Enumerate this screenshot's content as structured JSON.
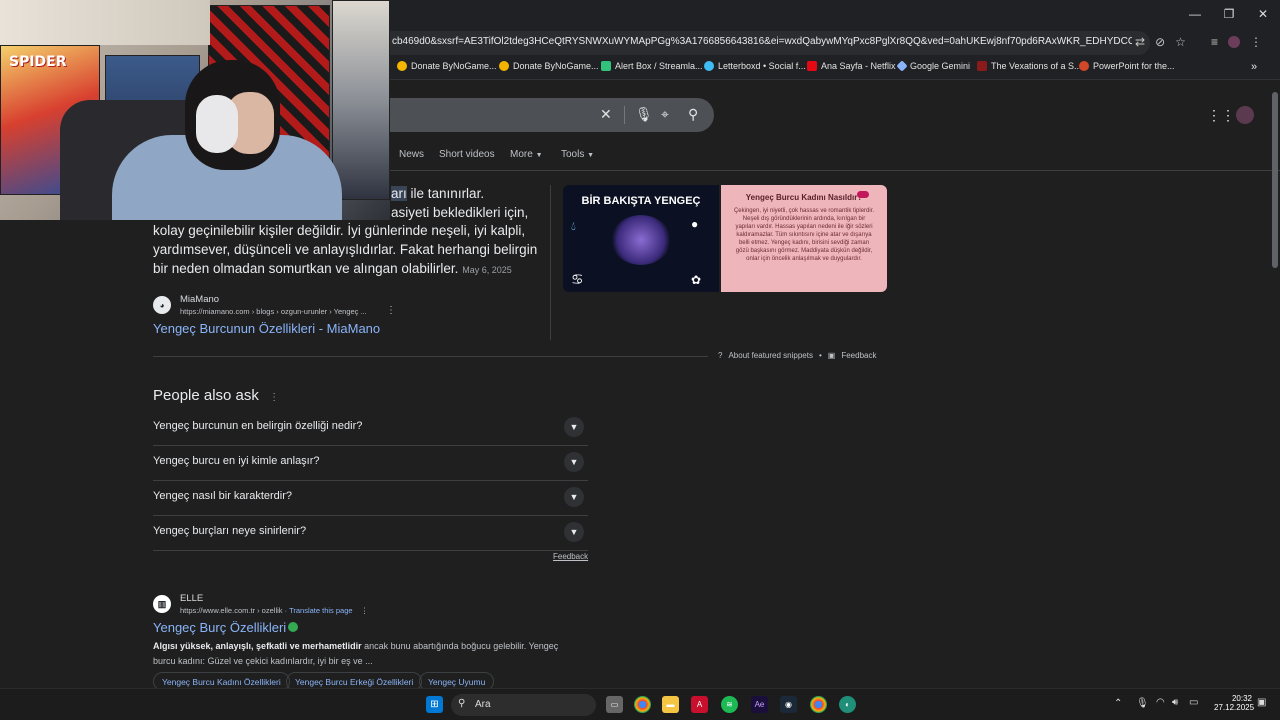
{
  "window": {
    "minimize": "—",
    "maximize": "❐",
    "close": "✕"
  },
  "url": "cb469d0&sxsrf=AE3TifOl2tdeg3HCeQtRYSNWXuWYMApPGg%3A1766856643816&ei=wxdQabywMYqPxc8PglXr8QQ&ved=0ahUKEwj8nf70pd6RAxWKR_EDHYDCOk4Q4dUDCBA...",
  "bookmarks": [
    {
      "label": "Donate ByNoGame...",
      "color": "#f5b400"
    },
    {
      "label": "Donate ByNoGame...",
      "color": "#f5b400"
    },
    {
      "label": "Alert Box / Streamla...",
      "color": "#31c27c"
    },
    {
      "label": "Letterboxd • Social f...",
      "color": "#40bcf4"
    },
    {
      "label": "Ana Sayfa - Netflix",
      "color": "#e50914"
    },
    {
      "label": "Google Gemini",
      "color": "#8ab4f8"
    },
    {
      "label": "The Vexations of a S...",
      "color": "#8b1a1a"
    },
    {
      "label": "PowerPoint for the...",
      "color": "#d24726"
    }
  ],
  "tabs": {
    "news": "News",
    "short_videos": "Short videos",
    "more": "More",
    "tools": "Tools"
  },
  "snippet": {
    "line0a": "arı",
    "line0b": "ile tanınırlar.",
    "line1": "asiyeti bekledikleri için,",
    "line2": "kolay geçinilebilir kişiler değildir. İyi günlerinde neşeli, iyi kalpli,",
    "line3": "yardımsever, düşünceli ve anlayışlıdırlar. Fakat herhangi belirgin",
    "line4": "bir neden olmadan somurtkan ve alıngan olabilirler.",
    "date": "May 6, 2025",
    "source_name": "MiaMano",
    "source_url": "https://miamano.com › blogs › ozgun-urunler › Yengeç ...",
    "link": "Yengeç Burcunun Özellikleri - MiaMano",
    "about": "About featured snippets",
    "feedback": "Feedback"
  },
  "images": {
    "img1_title": "BİR BAKIŞTA YENGEÇ",
    "img2_title": "Yengeç Burcu Kadını Nasıldır?",
    "img2_text": "Çekingen, iyi niyetli, çok hassas ve romantik tiplerdir. Neşeli dış göründüklerinin ardında, kırılgan bir yapıları vardır. Hassas yapıları nedeni ile iğir sözleri kaldıramazlar. Tüm sıkıntısını içine atar ve dışarıya belli etmez. Yengeç kadını, birisini sevdiği zaman gözü başkasını görmez. Maddiyata düşkün değildir, onlar için öncelik anlaşılmak ve duygulardır."
  },
  "paa": {
    "title": "People also ask",
    "questions": [
      "Yengeç burcunun en belirgin özelliği nedir?",
      "Yengeç burcu en iyi kimle anlaşır?",
      "Yengeç nasıl bir karakterdir?",
      "Yengeç burçları neye sinirlenir?"
    ],
    "feedback": "Feedback"
  },
  "result2": {
    "site": "ELLE",
    "url": "https://www.elle.com.tr › ozellik",
    "translate": "Translate this page",
    "title": "Yengeç Burç Özellikleri",
    "desc_bold": "Algısı yüksek, anlayışlı, şefkatli ve merhametlidir",
    "desc_rest": " ancak bunu abartığında boğucu gelebilir. Yengeç",
    "desc_line2": "burcu kadını: Güzel ve çekici kadınlardır, iyi bir eş ve ...",
    "chips": [
      "Yengeç Burcu Kadını Özellikleri",
      "Yengeç Burcu Erkeği Özellikleri",
      "Yengeç Uyumu"
    ]
  },
  "taskbar": {
    "search_label": "Ara",
    "time": "20:32",
    "date": "27.12.2025"
  }
}
